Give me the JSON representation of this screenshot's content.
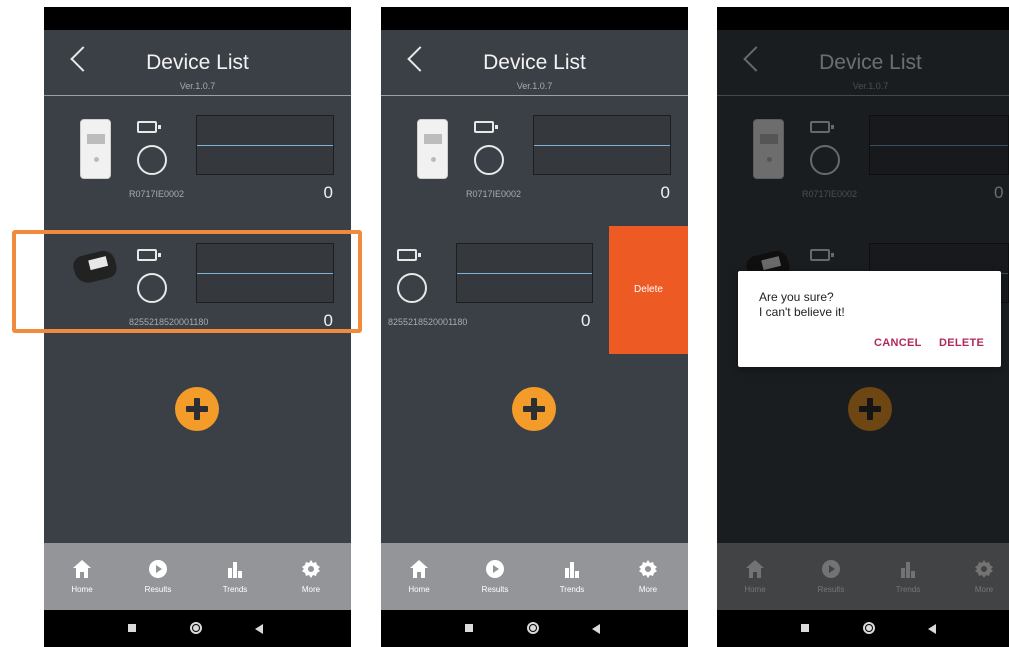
{
  "header": {
    "title": "Device List",
    "version": "Ver.1.0.7"
  },
  "devices": [
    {
      "serial": "R0717IE0002",
      "count": "0",
      "icon": "blood-pressure-cradle"
    },
    {
      "serial": "8255218520001180",
      "count": "0",
      "icon": "pulse-oximeter"
    }
  ],
  "swipe": {
    "delete_label": "Delete"
  },
  "dialog": {
    "line1": "Are you sure?",
    "line2": "I can't believe it!",
    "cancel_label": "CANCEL",
    "delete_label": "DELETE"
  },
  "tabs": [
    {
      "label": "Home",
      "icon": "home-icon"
    },
    {
      "label": "Results",
      "icon": "play-icon"
    },
    {
      "label": "Trends",
      "icon": "bar-chart-icon"
    },
    {
      "label": "More",
      "icon": "gear-icon"
    }
  ],
  "colors": {
    "background": "#3b4046",
    "accent": "#f39c2a",
    "delete": "#ee5a24",
    "highlight": "#f08a3c",
    "dialog_button": "#b0295e",
    "tabbar": "#939598"
  }
}
